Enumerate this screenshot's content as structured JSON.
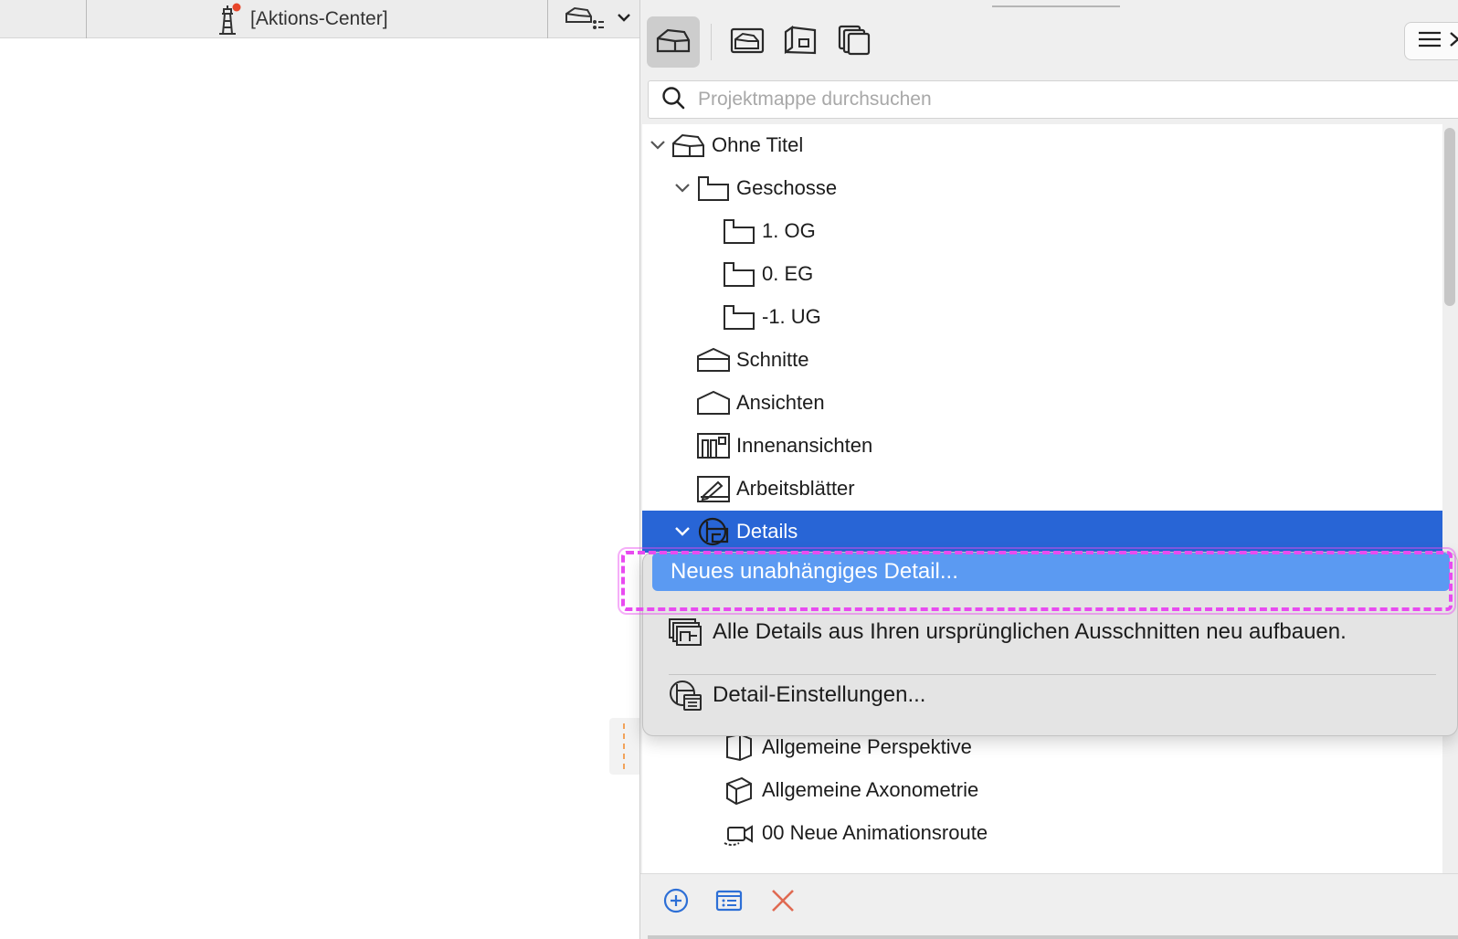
{
  "left_toolbar": {
    "aktions_label": "[Aktions-Center]"
  },
  "panel": {
    "tabs": [
      {
        "icon": "project-map-icon",
        "active": true
      },
      {
        "icon": "view-map-icon",
        "active": false
      },
      {
        "icon": "layout-book-icon",
        "active": false
      },
      {
        "icon": "publisher-sets-icon",
        "active": false
      }
    ],
    "search_placeholder": "Projektmappe durchsuchen",
    "tree": {
      "root": "Ohne Titel",
      "geschosse": "Geschosse",
      "story_1": "1. OG",
      "story_2": "0. EG",
      "story_3": "-1. UG",
      "schnitte": "Schnitte",
      "ansichten": "Ansichten",
      "innenansichten": "Innenansichten",
      "arbeitsblaetter": "Arbeitsblätter",
      "details": "Details",
      "perspektive": "Allgemeine Perspektive",
      "axonometrie": "Allgemeine Axonometrie",
      "animation": "00 Neue Animationsroute"
    }
  },
  "context_menu": {
    "item_new": "Neues unabhängiges Detail...",
    "item_rebuild": "Alle Details aus Ihren ursprünglichen Ausschnitten neu aufbauen.",
    "item_settings": "Detail-Einstellungen..."
  },
  "colors": {
    "selection": "#2865d6",
    "menu_highlight": "#5b9af2",
    "annotation": "#e84bf0",
    "delete": "#e06a52",
    "action_blue": "#2d6fd6"
  }
}
